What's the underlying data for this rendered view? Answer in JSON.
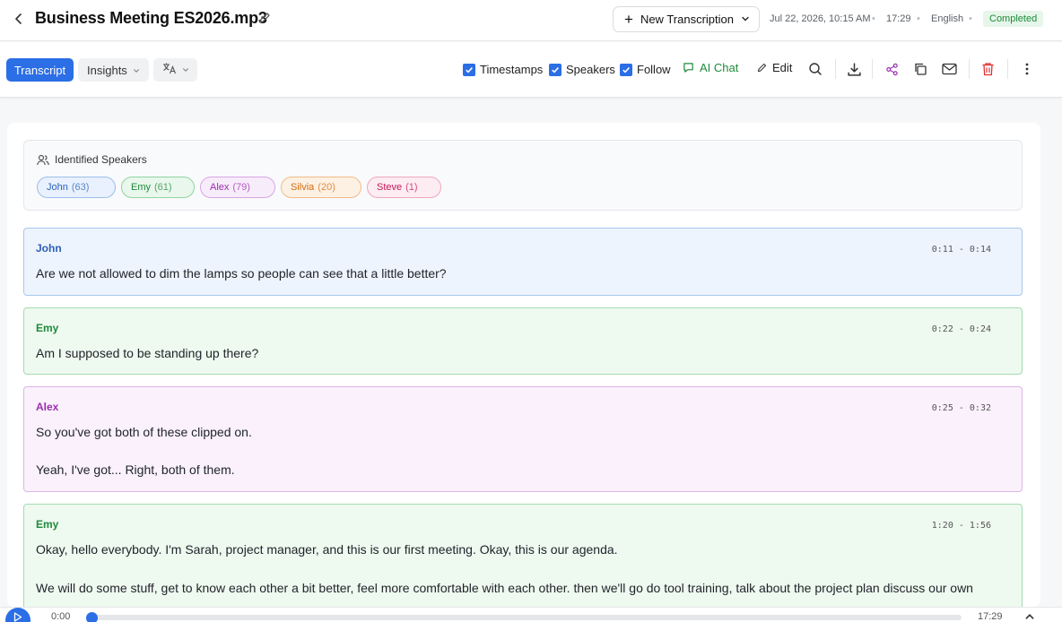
{
  "header": {
    "title": "Business Meeting ES2026.mp3",
    "new_transcription_label": "New Transcription",
    "date": "Jul 22, 2026, 10:15 AM",
    "duration": "17:29",
    "language": "English",
    "status": "Completed"
  },
  "toolbar": {
    "tabs": [
      {
        "label": "Transcript",
        "active": true
      },
      {
        "label": "Insights",
        "active": false
      }
    ],
    "toggles": {
      "timestamps": {
        "label": "Timestamps",
        "checked": true
      },
      "speakers": {
        "label": "Speakers",
        "checked": true
      },
      "follow": {
        "label": "Follow",
        "checked": true
      }
    },
    "ai_chat_label": "AI Chat",
    "edit_label": "Edit"
  },
  "speakers_panel": {
    "title": "Identified Speakers",
    "speakers": [
      {
        "name": "John",
        "count": "(63)"
      },
      {
        "name": "Emy",
        "count": "(61)"
      },
      {
        "name": "Alex",
        "count": "(79)"
      },
      {
        "name": "Silvia",
        "count": "(20)"
      },
      {
        "name": "Steve",
        "count": "(1)"
      }
    ]
  },
  "segments": [
    {
      "speaker": "John",
      "time": "0:11 - 0:14",
      "lines": [
        "Are we not allowed to dim the lamps so people can see that a little better?"
      ]
    },
    {
      "speaker": "Emy",
      "time": "0:22 - 0:24",
      "lines": [
        "Am I supposed to be standing up there?"
      ]
    },
    {
      "speaker": "Alex",
      "time": "0:25 - 0:32",
      "lines": [
        "So you've got both of these clipped on.",
        "Yeah, I've got... Right, both of them."
      ]
    },
    {
      "speaker": "Emy",
      "time": "1:20 - 1:56",
      "lines": [
        "Okay, hello everybody. I'm Sarah, project manager, and this is our first meeting. Okay, this is our agenda.",
        "We will do some stuff, get to know each other a bit better, feel more comfortable with each other. then we'll go do tool training, talk about the project plan discuss our own"
      ]
    }
  ],
  "player": {
    "current_time": "0:00",
    "total_time": "17:29",
    "progress": 0
  },
  "colors": {
    "accent": "#2b6ee6",
    "john": "#2b5fb8",
    "emy": "#1f8a3b",
    "alex": "#9b2fae",
    "silvia": "#d46a0c",
    "steve": "#c2185b",
    "delete": "#e03131"
  },
  "icons": [
    "back-chevron-icon",
    "pencil-icon",
    "plus-icon",
    "chevron-down-icon",
    "translate-icon",
    "check-icon",
    "chat-icon",
    "search-icon",
    "download-icon",
    "share-icon",
    "copy-icon",
    "mail-icon",
    "trash-icon",
    "more-vertical-icon",
    "users-icon",
    "play-icon",
    "chevron-up-icon"
  ]
}
